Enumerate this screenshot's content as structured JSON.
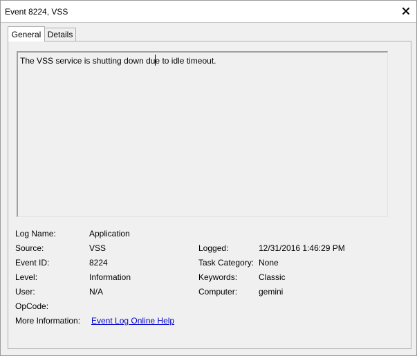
{
  "window": {
    "title": "Event 8224, VSS"
  },
  "tabs": [
    {
      "label": "General",
      "selected": true
    },
    {
      "label": "Details",
      "selected": false
    }
  ],
  "description": "The VSS service is shutting down due to idle timeout.",
  "fields": {
    "log_name": {
      "label": "Log Name:",
      "value": "Application"
    },
    "source": {
      "label": "Source:",
      "value": "VSS"
    },
    "event_id": {
      "label": "Event ID:",
      "value": "8224"
    },
    "level": {
      "label": "Level:",
      "value": "Information"
    },
    "user": {
      "label": "User:",
      "value": "N/A"
    },
    "opcode": {
      "label": "OpCode:",
      "value": ""
    },
    "more_information": {
      "label": "More Information:",
      "link": "Event Log Online Help"
    },
    "logged": {
      "label": "Logged:",
      "value": "12/31/2016 1:46:29 PM"
    },
    "task_category": {
      "label": "Task Category:",
      "value": "None"
    },
    "keywords": {
      "label": "Keywords:",
      "value": "Classic"
    },
    "computer": {
      "label": "Computer:",
      "value": "gemini"
    }
  },
  "colors": {
    "link": "#0000cc",
    "panel_background": "#f0f0f0",
    "titlebar_background": "#ffffff"
  },
  "icons": {
    "close": "close-icon"
  }
}
